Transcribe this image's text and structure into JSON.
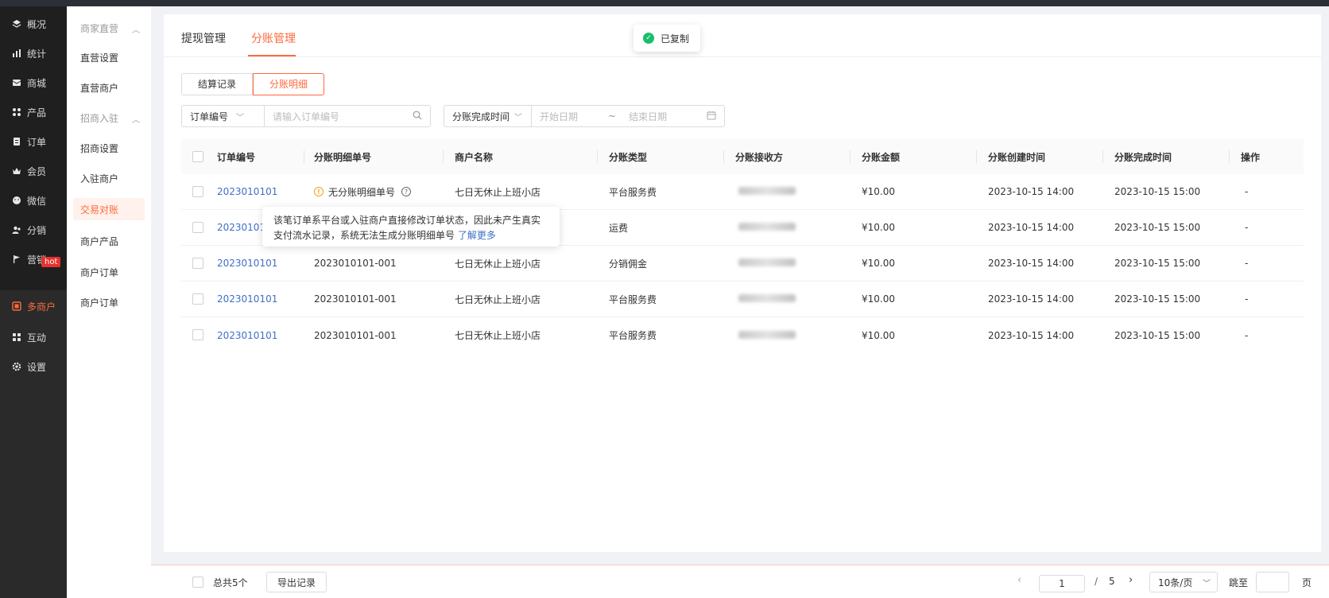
{
  "nav": {
    "items": [
      {
        "label": "概况",
        "icon": "layers-icon"
      },
      {
        "label": "统计",
        "icon": "chart-icon"
      },
      {
        "label": "商城",
        "icon": "mail-icon"
      },
      {
        "label": "产品",
        "icon": "grid-icon"
      },
      {
        "label": "订单",
        "icon": "clipboard-icon"
      },
      {
        "label": "会员",
        "icon": "crown-icon"
      },
      {
        "label": "微信",
        "icon": "chat-icon"
      },
      {
        "label": "分销",
        "icon": "users-icon"
      },
      {
        "label": "营销",
        "icon": "flag-icon"
      },
      {
        "label": "多商户",
        "icon": "store-icon"
      },
      {
        "label": "互动",
        "icon": "apps-icon"
      },
      {
        "label": "设置",
        "icon": "gear-icon"
      }
    ],
    "hot_badge": "hot"
  },
  "subnav": {
    "items": [
      {
        "label": "商家直营",
        "group": true
      },
      {
        "label": "直营设置"
      },
      {
        "label": "直营商户"
      },
      {
        "label": "招商入驻",
        "group": true
      },
      {
        "label": "招商设置"
      },
      {
        "label": "入驻商户"
      },
      {
        "label": "交易对账",
        "active": true
      },
      {
        "label": "商户产品"
      },
      {
        "label": "商户订单"
      },
      {
        "label": "商户订单"
      }
    ]
  },
  "tabs": [
    "提现管理",
    "分账管理"
  ],
  "toast": "已复制",
  "segment": [
    "结算记录",
    "分账明细"
  ],
  "filters": {
    "order_select": "订单编号",
    "order_placeholder": "请输入订单编号",
    "time_select": "分账完成时间",
    "start_placeholder": "开始日期",
    "range_sep": "~",
    "end_placeholder": "结束日期"
  },
  "table": {
    "columns": [
      "订单编号",
      "分账明细单号",
      "商户名称",
      "分账类型",
      "分账接收方",
      "分账金额",
      "分账创建时间",
      "分账完成时间",
      "操作"
    ],
    "rows": [
      {
        "order": "2023010101",
        "detail": "无分账明细单号",
        "merchant": "七日无休止上班小店",
        "type": "平台服务费",
        "amount": "¥10.00",
        "created": "2023-10-15  14:00",
        "done": "2023-10-15  15:00",
        "op": "-"
      },
      {
        "order": "20230101",
        "detail": "",
        "merchant": "",
        "type": "运费",
        "amount": "¥10.00",
        "created": "2023-10-15  14:00",
        "done": "2023-10-15  15:00",
        "op": "-"
      },
      {
        "order": "2023010101",
        "detail": "2023010101-001",
        "merchant": "七日无休止上班小店",
        "type": "分销佣金",
        "amount": "¥10.00",
        "created": "2023-10-15  14:00",
        "done": "2023-10-15  15:00",
        "op": "-"
      },
      {
        "order": "2023010101",
        "detail": "2023010101-001",
        "merchant": "七日无休止上班小店",
        "type": "平台服务费",
        "amount": "¥10.00",
        "created": "2023-10-15  14:00",
        "done": "2023-10-15  15:00",
        "op": "-"
      },
      {
        "order": "2023010101",
        "detail": "2023010101-001",
        "merchant": "七日无休止上班小店",
        "type": "平台服务费",
        "amount": "¥10.00",
        "created": "2023-10-15  14:00",
        "done": "2023-10-15  15:00",
        "op": "-"
      }
    ]
  },
  "tooltip": {
    "line1": "该笔订单系平台或入驻商户直接修改订单状态，因此未产生真实",
    "line2": "支付流水记录，系统无法生成分账明细单号",
    "more": "了解更多"
  },
  "footer": {
    "total": "总共5个",
    "export": "导出记录",
    "page": "1",
    "page_sep": "/",
    "pages": "5",
    "page_size": "10条/页",
    "jump_label": "跳至",
    "page_unit": "页"
  }
}
